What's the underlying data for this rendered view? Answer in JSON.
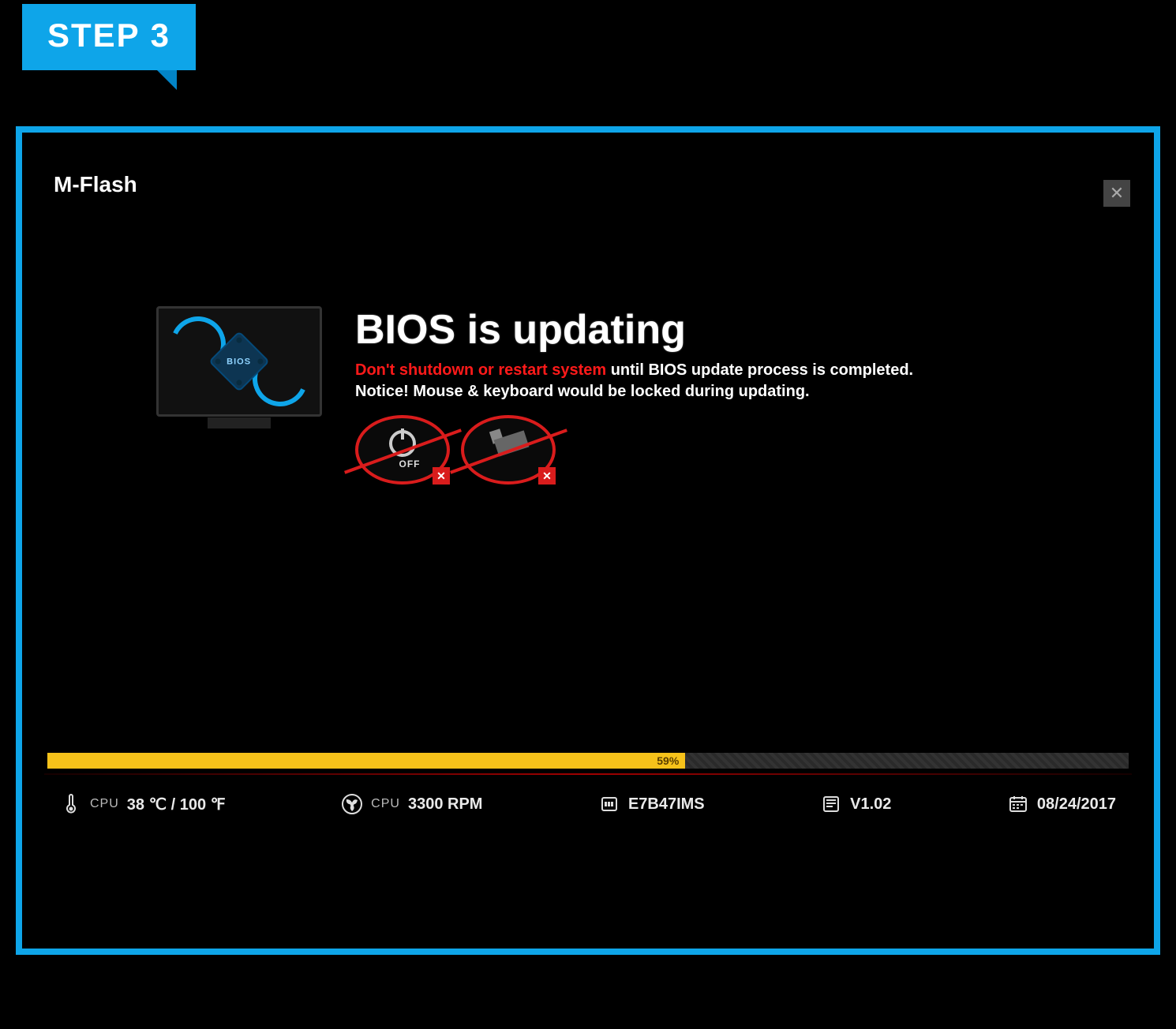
{
  "badge": {
    "label": "STEP 3"
  },
  "window": {
    "title": "M-Flash",
    "close_aria": "Close"
  },
  "graphic": {
    "chip_label": "BIOS"
  },
  "message": {
    "headline": "BIOS is updating",
    "warn_red": "Don't shutdown or restart system",
    "warn_white": " until BIOS update process is completed.",
    "notice": "Notice! Mouse & keyboard would be locked during updating."
  },
  "prohibit": {
    "power_off_label": "OFF"
  },
  "progress": {
    "percent": 59,
    "percent_label": "59%"
  },
  "status": {
    "temp": {
      "label": "CPU",
      "value": "38 ℃ / 100 ℉"
    },
    "fan": {
      "label": "CPU",
      "value": "3300 RPM"
    },
    "bios": {
      "value": "E7B47IMS"
    },
    "ver": {
      "value": "V1.02"
    },
    "date": {
      "value": "08/24/2017"
    }
  }
}
